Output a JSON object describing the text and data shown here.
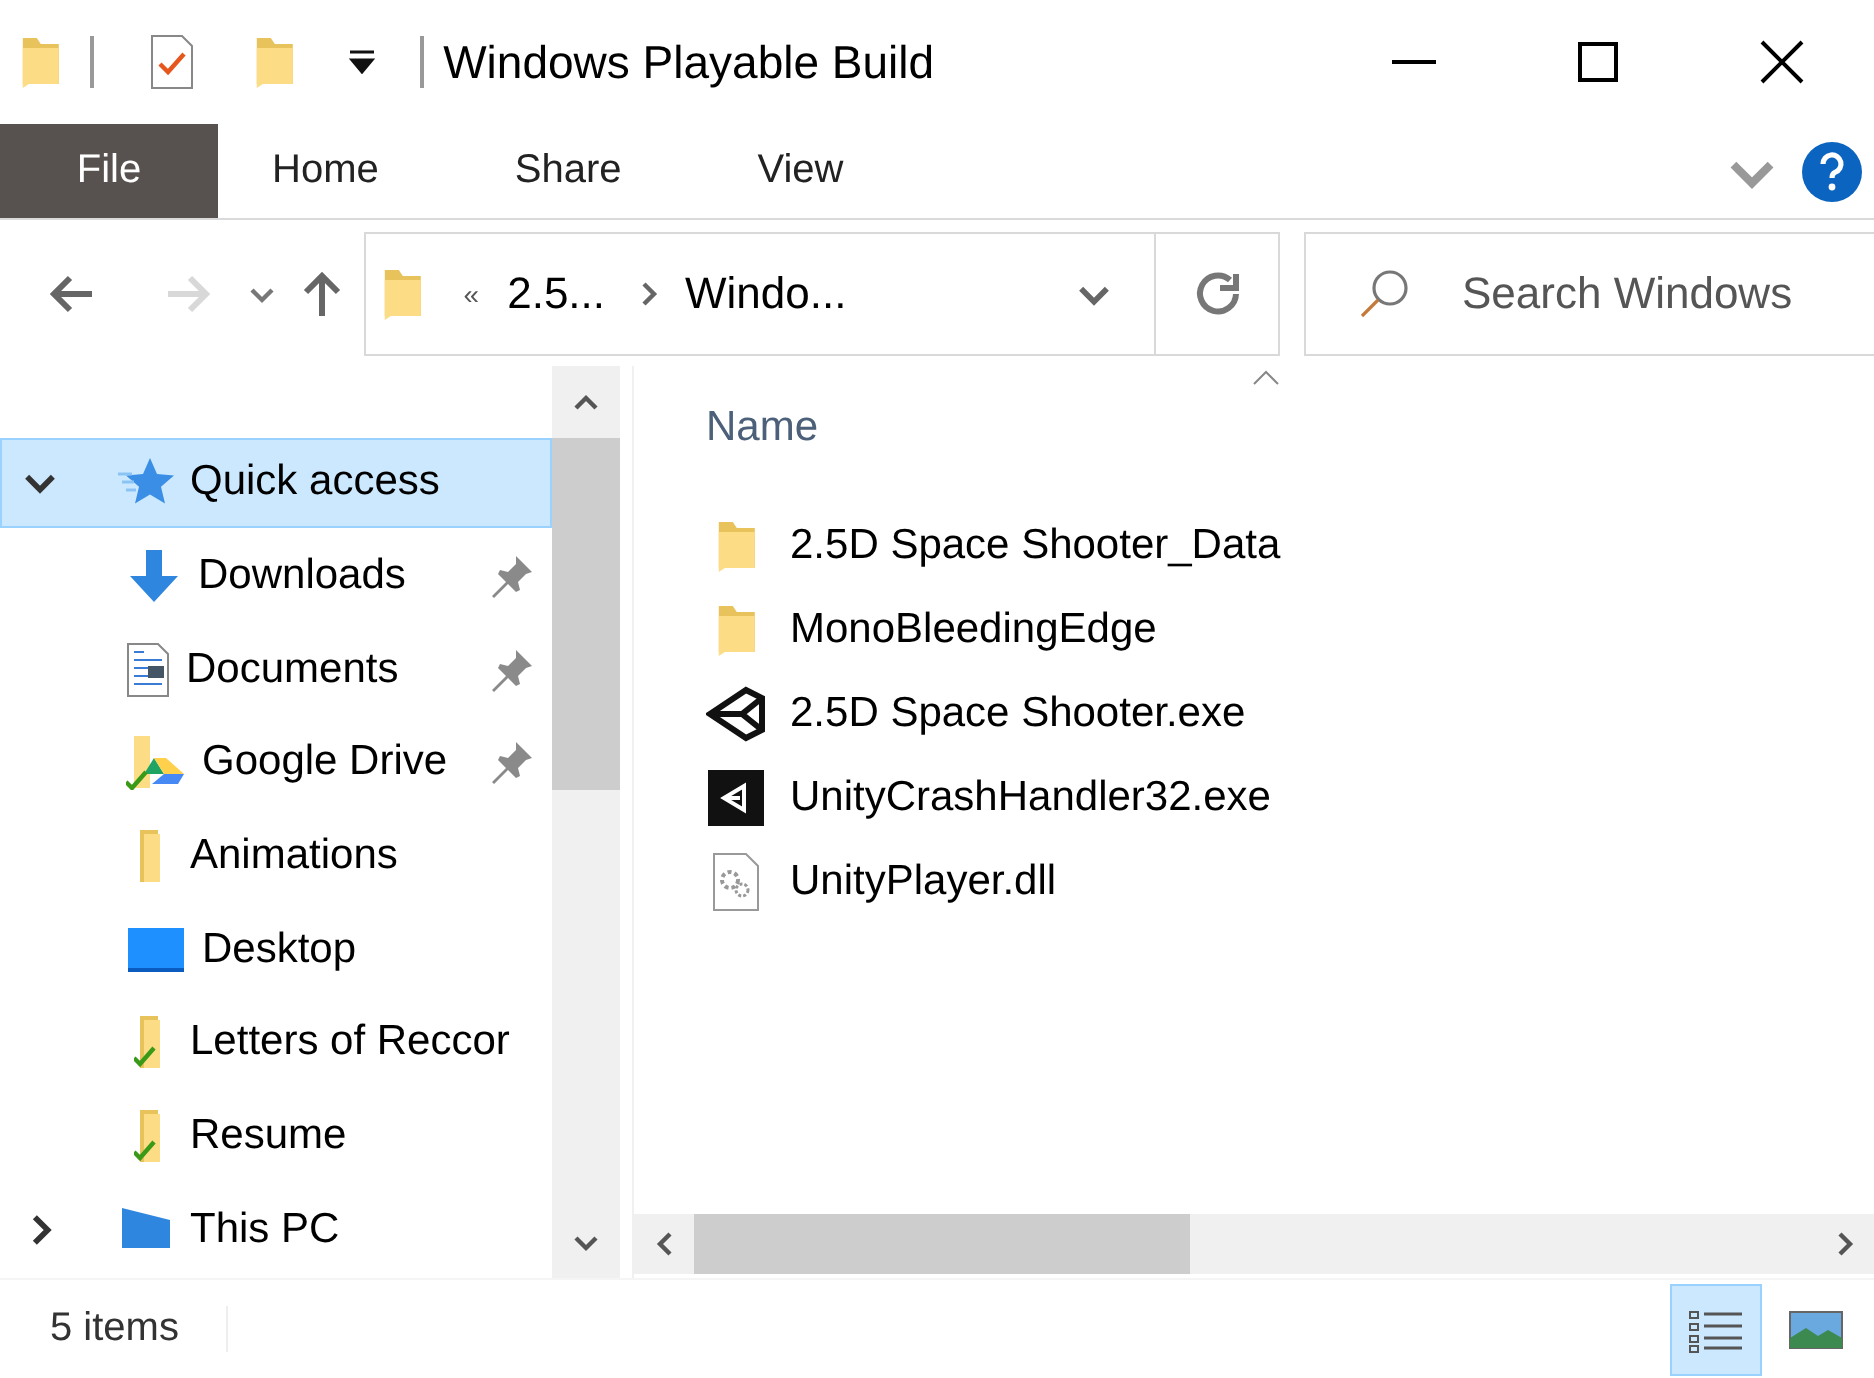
{
  "window": {
    "title": "Windows Playable Build"
  },
  "ribbon_tabs": [
    {
      "label": "File",
      "kind": "file"
    },
    {
      "label": "Home",
      "kind": "tab"
    },
    {
      "label": "Share",
      "kind": "tab"
    },
    {
      "label": "View",
      "kind": "tab"
    }
  ],
  "address": {
    "overflow_mark": "«",
    "crumbs": [
      "2.5...",
      "Windo..."
    ]
  },
  "search": {
    "placeholder": "Search Windows"
  },
  "nav": [
    {
      "label": "Quick access",
      "kind": "star",
      "expanded": true,
      "selected": true,
      "children": [
        {
          "label": "Downloads",
          "kind": "downloads",
          "pinned": true,
          "synced": false
        },
        {
          "label": "Documents",
          "kind": "documents",
          "pinned": true,
          "synced": false
        },
        {
          "label": "Google Drive",
          "kind": "drive",
          "pinned": true,
          "synced": true
        },
        {
          "label": "Animations",
          "kind": "folder",
          "pinned": false,
          "synced": false
        },
        {
          "label": "Desktop",
          "kind": "desktop",
          "pinned": false,
          "synced": false
        },
        {
          "label": "Letters of Reccor",
          "kind": "folder",
          "pinned": false,
          "synced": true
        },
        {
          "label": "Resume",
          "kind": "folder",
          "pinned": false,
          "synced": true
        }
      ]
    },
    {
      "label": "This PC",
      "kind": "pc",
      "expanded": false,
      "selected": false
    }
  ],
  "files": {
    "column": "Name",
    "rows": [
      {
        "name": "2.5D Space Shooter_Data",
        "kind": "folder"
      },
      {
        "name": "MonoBleedingEdge",
        "kind": "folder"
      },
      {
        "name": "2.5D Space Shooter.exe",
        "kind": "unity"
      },
      {
        "name": "UnityCrashHandler32.exe",
        "kind": "unity-dark"
      },
      {
        "name": "UnityPlayer.dll",
        "kind": "dll"
      }
    ]
  },
  "status_bar": {
    "count": "5 items",
    "views": [
      {
        "kind": "details",
        "selected": true
      },
      {
        "kind": "large-icons",
        "selected": false
      }
    ]
  }
}
